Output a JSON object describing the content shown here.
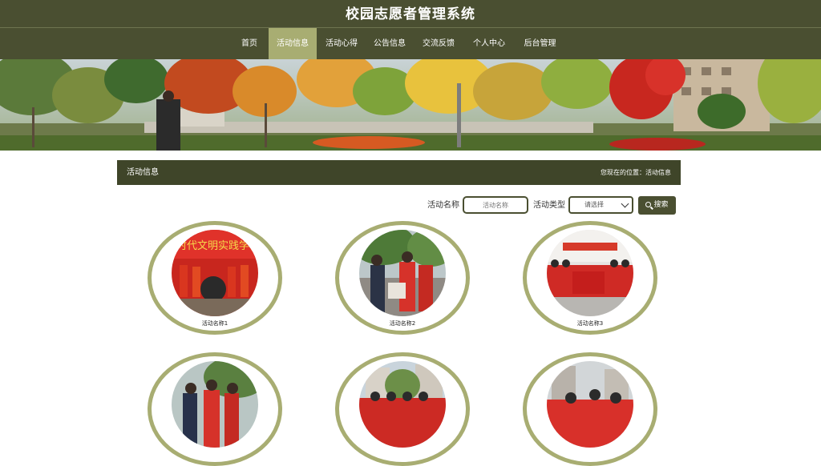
{
  "site": {
    "title": "校园志愿者管理系统"
  },
  "nav": {
    "items": [
      {
        "label": "首页"
      },
      {
        "label": "活动信息"
      },
      {
        "label": "活动心得"
      },
      {
        "label": "公告信息"
      },
      {
        "label": "交流反馈"
      },
      {
        "label": "个人中心"
      },
      {
        "label": "后台管理"
      }
    ],
    "active_index": 1
  },
  "panel": {
    "title": "活动信息",
    "breadcrumb": "您现在的位置：活动信息"
  },
  "search": {
    "name_label": "活动名称",
    "name_placeholder": "活动名称",
    "type_label": "活动类型",
    "type_selected": "请选择",
    "button_label": "搜索"
  },
  "activities": [
    {
      "name": "活动名称1"
    },
    {
      "name": "活动名称2"
    },
    {
      "name": "活动名称3"
    },
    {
      "name": ""
    },
    {
      "name": ""
    },
    {
      "name": ""
    }
  ],
  "colors": {
    "primary": "#4a4f31",
    "accent": "#a8ad72",
    "panel": "#3f4529"
  }
}
